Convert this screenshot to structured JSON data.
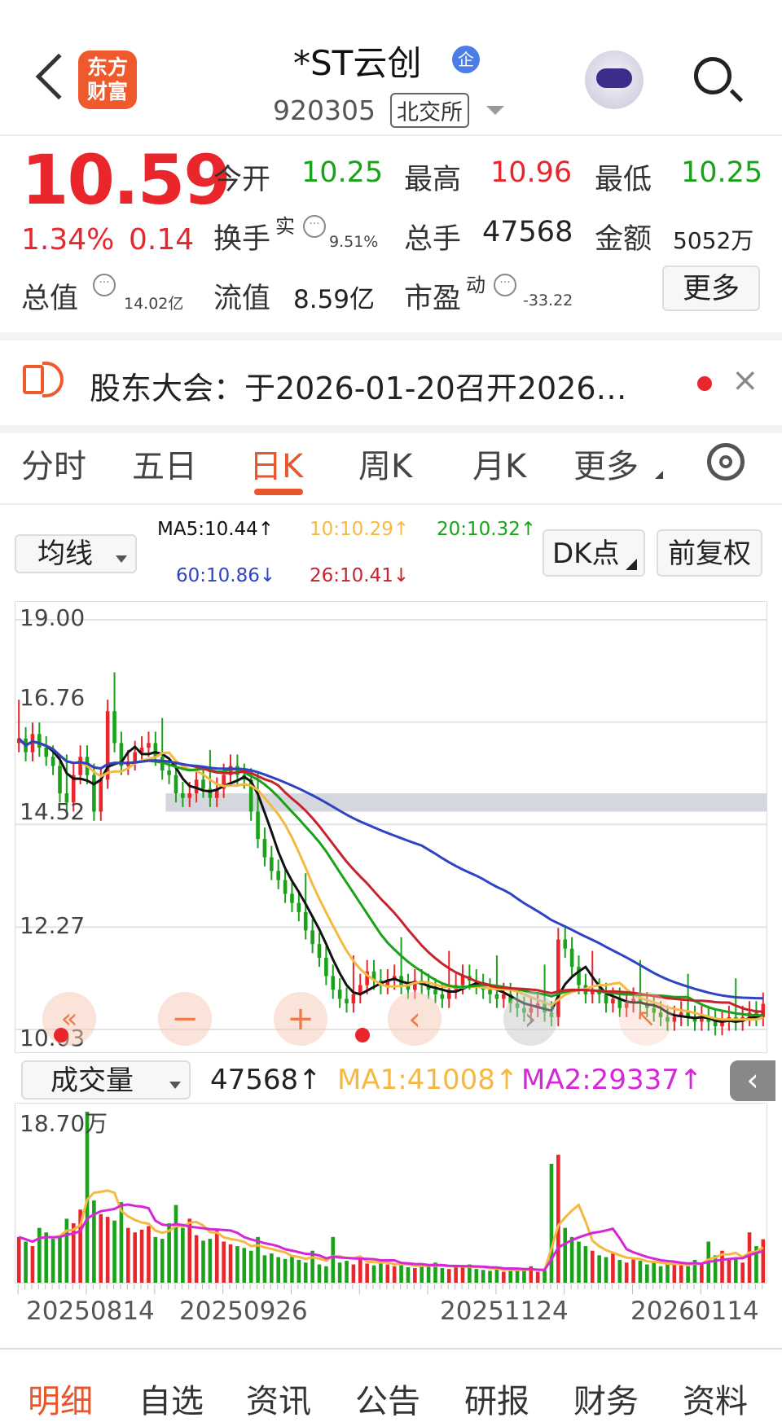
{
  "header": {
    "logo_line1": "东方",
    "logo_line2": "财富",
    "stock_name": "*ST云创",
    "badge": "企",
    "code": "920305",
    "exchange": "北交所"
  },
  "quote": {
    "price": "10.59",
    "change_pct": "1.34%",
    "change": "0.14",
    "open_label": "今开",
    "open": "10.25",
    "high_label": "最高",
    "high": "10.96",
    "low_label": "最低",
    "low": "10.25",
    "turnover_label": "换手",
    "turnover_sup": "实",
    "turnover": "9.51%",
    "volume_label": "总手",
    "volume": "47568",
    "amount_label": "金额",
    "amount": "5052万",
    "mktcap_label": "总值",
    "mktcap": "14.02亿",
    "float_label": "流值",
    "float_cap": "8.59亿",
    "pe_label": "市盈",
    "pe_sup": "动",
    "pe": "-33.22",
    "more": "更多"
  },
  "notice": {
    "text": "股东大会：于2026-01-20召开2026…",
    "close": "×"
  },
  "tabs": [
    "分时",
    "五日",
    "日K",
    "周K",
    "月K",
    "更多"
  ],
  "controls": {
    "indicator": "均线",
    "dk": "DK点",
    "adjust": "前复权",
    "ma5": "MA5:10.44↑",
    "ma10": "10:10.29↑",
    "ma20": "20:10.32↑",
    "ma60": "60:10.86↓",
    "ma26": "26:10.41↓",
    "vol_indicator": "成交量",
    "vol_value": "47568↑",
    "vol_ma1": "MA1:41008↑",
    "vol_ma2": "MA2:29337↑"
  },
  "colors": {
    "up": "#e8262c",
    "down": "#1aa21a",
    "ma5": "#111111",
    "ma10": "#f5b942",
    "ma20": "#1aa21a",
    "ma60": "#2d44c4",
    "ma26": "#c8232c",
    "vol_ma1": "#f5b942",
    "vol_ma2": "#d526d8"
  },
  "chart_data": {
    "type": "candlestick",
    "y_ticks": [
      "19.00",
      "16.76",
      "14.52",
      "12.27",
      "10.03"
    ],
    "ylim": [
      10.03,
      19.0
    ],
    "vol_max_label": "18.70万",
    "vol_ylim": [
      0,
      187000
    ],
    "x_ticks": [
      "20250814",
      "20250926",
      "20251124",
      "20260114"
    ],
    "close": [
      16.4,
      16.1,
      16.5,
      16.2,
      16.0,
      15.8,
      15.2,
      15.0,
      15.6,
      16.0,
      15.6,
      14.8,
      15.5,
      17.0,
      16.3,
      15.8,
      15.9,
      16.1,
      16.2,
      16.3,
      16.0,
      15.7,
      15.6,
      15.2,
      15.1,
      15.2,
      15.5,
      15.3,
      15.1,
      15.3,
      15.6,
      15.8,
      15.6,
      15.5,
      14.8,
      14.2,
      13.8,
      13.5,
      13.3,
      13.0,
      12.8,
      12.6,
      12.2,
      11.9,
      11.6,
      11.2,
      10.9,
      10.7,
      10.6,
      10.8,
      11.0,
      11.3,
      11.1,
      11.0,
      11.1,
      11.2,
      11.0,
      10.9,
      11.1,
      11.0,
      10.9,
      10.8,
      10.7,
      10.9,
      11.0,
      11.2,
      11.1,
      11.0,
      10.9,
      10.8,
      10.7,
      10.8,
      10.6,
      10.5,
      10.4,
      10.5,
      10.6,
      10.4,
      10.3,
      12.0,
      11.8,
      11.4,
      11.0,
      10.8,
      10.9,
      10.8,
      10.6,
      10.7,
      10.5,
      10.6,
      10.7,
      10.6,
      10.5,
      10.4,
      10.3,
      10.2,
      10.3,
      10.4,
      10.3,
      10.2,
      10.3,
      10.2,
      10.1,
      10.2,
      10.3,
      10.2,
      10.3,
      10.4,
      10.3,
      10.59
    ],
    "volume": [
      50000,
      45000,
      40000,
      60000,
      55000,
      48000,
      52000,
      70000,
      65000,
      80000,
      187000,
      90000,
      75000,
      72000,
      68000,
      88000,
      60000,
      55000,
      58000,
      62000,
      50000,
      48000,
      65000,
      85000,
      60000,
      70000,
      52000,
      46000,
      48000,
      58000,
      45000,
      42000,
      40000,
      38000,
      35000,
      50000,
      30000,
      32000,
      28000,
      26000,
      30000,
      25000,
      22000,
      35000,
      20000,
      18000,
      50000,
      22000,
      24000,
      20000,
      28000,
      21000,
      19000,
      23000,
      20000,
      18000,
      22000,
      17000,
      16000,
      20000,
      18000,
      22000,
      16000,
      15000,
      19000,
      17000,
      20000,
      15000,
      14000,
      13000,
      16000,
      12000,
      15000,
      14000,
      13000,
      18000,
      12000,
      14000,
      130000,
      140000,
      60000,
      50000,
      45000,
      40000,
      35000,
      30000,
      28000,
      32000,
      25000,
      22000,
      26000,
      24000,
      20000,
      22000,
      18000,
      20000,
      22000,
      19000,
      18000,
      25000,
      20000,
      45000,
      30000,
      35000,
      25000,
      28000,
      22000,
      55000,
      40000,
      47568
    ],
    "ma": [
      {
        "name": "MA5",
        "last": 10.44
      },
      {
        "name": "MA10",
        "last": 10.29
      },
      {
        "name": "MA20",
        "last": 10.32
      },
      {
        "name": "MA26",
        "last": 10.41
      },
      {
        "name": "MA60",
        "last": 10.86
      }
    ]
  },
  "bottom_tabs": [
    "明细",
    "自选",
    "资讯",
    "公告",
    "研报",
    "财务",
    "资料"
  ]
}
